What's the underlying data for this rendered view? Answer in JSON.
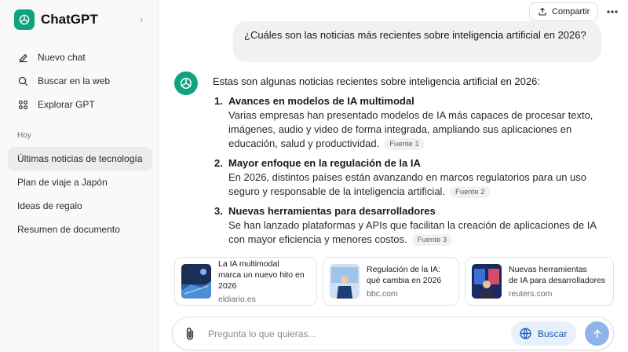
{
  "sidebar": {
    "brand": "ChatGPT",
    "nav": [
      {
        "label": "Nuevo chat",
        "icon": "edit-icon"
      },
      {
        "label": "Buscar en la web",
        "icon": "search-icon"
      },
      {
        "label": "Explorar GPT",
        "icon": "grid-icon"
      }
    ],
    "section_label": "Hoy",
    "history": [
      {
        "label": "Últimas noticias de tecnología",
        "active": true
      },
      {
        "label": "Plan de viaje a Japón",
        "active": false
      },
      {
        "label": "Ideas de regalo",
        "active": false
      },
      {
        "label": "Resumen de documento",
        "active": false
      }
    ]
  },
  "header": {
    "share_label": "Compartir",
    "more_icon": "more-dots-icon"
  },
  "conversation": {
    "user_message": "¿Cuáles son las noticias más recientes sobre inteligencia artificial en 2026?",
    "assistant_intro": "Estas son algunas noticias recientes sobre inteligencia artificial en 2026:",
    "items": [
      {
        "number": "1.",
        "title": "Avances en modelos de IA multimodal",
        "description": "Varias empresas han presentado modelos de IA más capaces de procesar texto, imágenes, audio y video de forma integrada, ampliando sus aplicaciones en educación, salud y productividad.",
        "source": "Fuente 1"
      },
      {
        "number": "2.",
        "title": "Mayor enfoque en la regulación de la IA",
        "description": "En 2026, distintos países están avanzando en marcos regulatorios para un uso seguro y responsable de la inteligencia artificial.",
        "source": "Fuente 2"
      },
      {
        "number": "3.",
        "title": "Nuevas herramientas para desarrolladores",
        "description": "Se han lanzado plataformas y APIs que facilitan la creación de aplicaciones de IA con mayor eficiencia y menores costos.",
        "source": "Fuente 3"
      }
    ],
    "source_cards": [
      {
        "title_line1": "La IA multimodal",
        "title_line2": "marca un nuevo hito en 2026",
        "domain": "eldiario.es"
      },
      {
        "title_line1": "Regulación de la IA:",
        "title_line2": "qué cambia en 2026",
        "domain": "bbc.com"
      },
      {
        "title_line1": "Nuevas herramientas",
        "title_line2": "de IA para desarrolladores",
        "domain": "reuters.com"
      }
    ]
  },
  "composer": {
    "placeholder": "Pregunta lo que quieras...",
    "search_label": "Buscar"
  },
  "colors": {
    "brand_green": "#10a37f",
    "accent_blue": "#1558b0",
    "send_button": "#8fb4e8"
  }
}
